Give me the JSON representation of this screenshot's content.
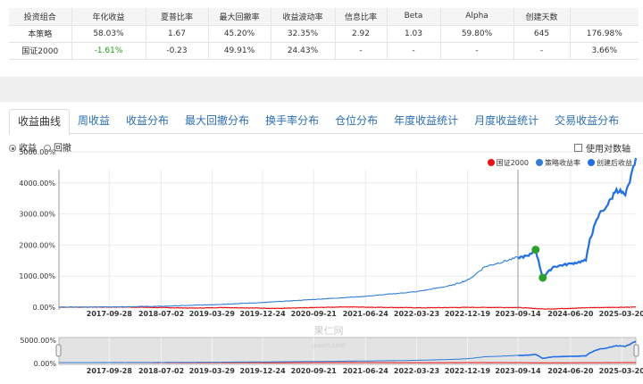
{
  "stats_table": {
    "headers": [
      "投资组合",
      "年化收益",
      "夏普比率",
      "最大回撤率",
      "收益波动率",
      "信息比率",
      "Beta",
      "Alpha",
      "创建天数",
      ""
    ],
    "rows": [
      [
        "本策略",
        "58.03%",
        "1.67",
        "45.20%",
        "32.35%",
        "2.92",
        "1.03",
        "59.80%",
        "645",
        "176.98%"
      ],
      [
        "国证2000",
        "-1.61%",
        "-0.23",
        "49.91%",
        "24.43%",
        "-",
        "-",
        "-",
        "-",
        "3.66%"
      ]
    ]
  },
  "tabs": [
    "收益曲线",
    "周收益",
    "收益分布",
    "最大回撤分布",
    "换手率分布",
    "仓位分布",
    "年度收益统计",
    "月度收益统计",
    "交易收益分布"
  ],
  "active_tab": 0,
  "radios": {
    "return": "收益",
    "drawdown": "回撤",
    "selected": "return"
  },
  "log_axis_label": "使用对数轴",
  "watermark": {
    "name": "果仁网",
    "url": "guorn.com"
  },
  "colors": {
    "benchmark": "#ee1111",
    "strategy": "#2f7ed8",
    "live": "#1f6fe8",
    "marker": "#2aa12a",
    "positive": "#333333",
    "negative": "#1a9e1a"
  },
  "chart_data": {
    "type": "line",
    "title": "",
    "ylabel": "",
    "ylim": [
      0,
      5000
    ],
    "yticks": [
      "0.00%",
      "1000.00%",
      "2000.00%",
      "3000.00%",
      "4000.00%",
      "5000.00%"
    ],
    "ytick_values": [
      0,
      1000,
      2000,
      3000,
      4000,
      5000
    ],
    "navigator_yticks": [
      "0.00%",
      "5000.00%"
    ],
    "xticks": [
      "2017-09-28",
      "2018-07-02",
      "2019-03-29",
      "2019-12-24",
      "2020-09-21",
      "2021-06-24",
      "2022-03-23",
      "2022-12-19",
      "2023-09-14",
      "2024-06-20",
      "2025-03-20"
    ],
    "xrange": [
      "2017-01-03",
      "2025-06-03"
    ],
    "creation_date": "2023-09-14",
    "legend": [
      "国证2000",
      "策略收益率",
      "创建后收益"
    ],
    "legend_position": "top-right",
    "series": [
      {
        "name": "国证2000",
        "points": [
          [
            "2017-01-03",
            0
          ],
          [
            "2018-01-10",
            5
          ],
          [
            "2018-12-20",
            -30
          ],
          [
            "2019-06-01",
            -10
          ],
          [
            "2020-03-20",
            -40
          ],
          [
            "2021-03-01",
            10
          ],
          [
            "2022-04-25",
            -20
          ],
          [
            "2023-01-10",
            -5
          ],
          [
            "2023-09-14",
            -10
          ],
          [
            "2024-02-05",
            -60
          ],
          [
            "2024-10-10",
            -15
          ],
          [
            "2025-06-03",
            5
          ]
        ]
      },
      {
        "name": "策略收益率",
        "points": [
          [
            "2017-01-03",
            0
          ],
          [
            "2017-09-28",
            10
          ],
          [
            "2018-07-02",
            30
          ],
          [
            "2019-03-29",
            80
          ],
          [
            "2019-12-24",
            150
          ],
          [
            "2020-09-21",
            250
          ],
          [
            "2021-06-24",
            350
          ],
          [
            "2022-03-23",
            500
          ],
          [
            "2022-09-27",
            700
          ],
          [
            "2022-12-30",
            900
          ],
          [
            "2023-03-20",
            1300
          ],
          [
            "2023-09-14",
            1600
          ]
        ]
      },
      {
        "name": "创建后收益",
        "points": [
          [
            "2023-09-14",
            1600
          ],
          [
            "2023-11-10",
            1650
          ],
          [
            "2023-12-17",
            1850
          ],
          [
            "2024-01-24",
            950
          ],
          [
            "2024-03-20",
            1300
          ],
          [
            "2024-06-20",
            1400
          ],
          [
            "2024-09-10",
            1500
          ],
          [
            "2024-10-01",
            2200
          ],
          [
            "2024-11-20",
            3000
          ],
          [
            "2025-01-05",
            3300
          ],
          [
            "2025-02-20",
            3800
          ],
          [
            "2025-04-08",
            3600
          ],
          [
            "2025-05-01",
            4000
          ],
          [
            "2025-06-03",
            4800
          ]
        ]
      }
    ],
    "markers": [
      {
        "date": "2023-12-17",
        "value": 1850
      },
      {
        "date": "2024-01-24",
        "value": 950
      }
    ]
  }
}
